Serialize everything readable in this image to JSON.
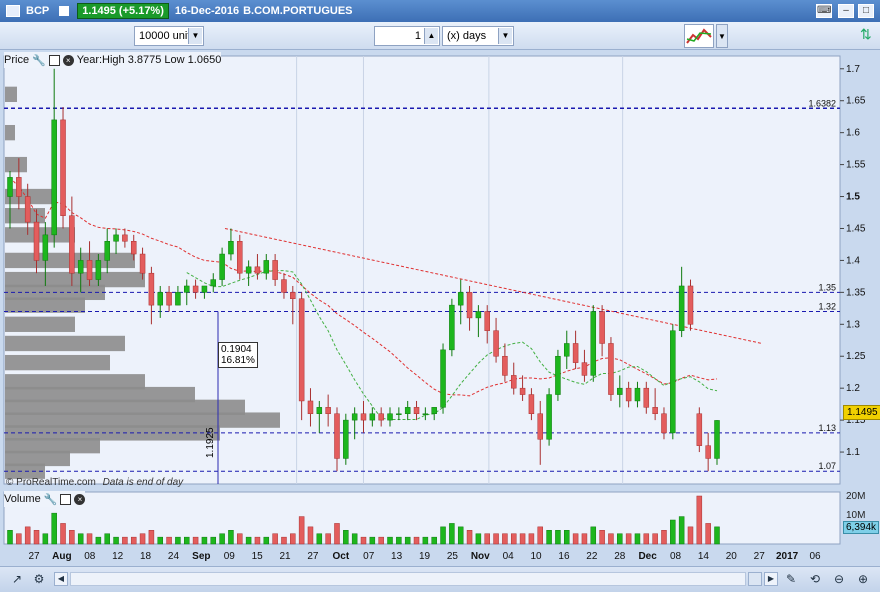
{
  "titlebar": {
    "symbol": "BCP",
    "price": "1.1495 (+5.17%)",
    "date": "16-Dec-2016",
    "exchange": "B.COM.PORTUGUES"
  },
  "toolbar": {
    "units_value": "10000 units",
    "period_value": "1",
    "period_unit": "(x) days"
  },
  "price_panel": {
    "label": "Price",
    "stats": "Year:High 3.8775 Low 1.0650",
    "watermark": "© ProRealTime.com",
    "end_note": "Data is end of day",
    "current_price": "1.1495",
    "measure_value": "0.1904",
    "measure_pct": "16.81%",
    "measure_low": "1.1925"
  },
  "volume_panel": {
    "label": "Volume",
    "current": "6,394k",
    "scale": [
      "20M",
      "10M"
    ]
  },
  "colors": {
    "up": "#1db61d",
    "down": "#e35d5d",
    "hline": "#1a1ab0",
    "ma": "#e03030",
    "ma2": "#44b044"
  },
  "chart_data": {
    "type": "candlestick",
    "y_axis_ticks": [
      "1.7",
      "1.65",
      "1.6",
      "1.55",
      "1.5",
      "1.45",
      "1.4",
      "1.35",
      "1.3",
      "1.25",
      "1.2",
      "1.15",
      "1.1"
    ],
    "ylim": [
      1.05,
      1.72
    ],
    "x_axis_ticks": [
      "27",
      "Aug",
      "08",
      "12",
      "18",
      "24",
      "Sep",
      "09",
      "15",
      "21",
      "27",
      "Oct",
      "07",
      "13",
      "19",
      "25",
      "Nov",
      "04",
      "10",
      "16",
      "22",
      "28",
      "Dec",
      "08",
      "14",
      "20",
      "27",
      "2017",
      "06"
    ],
    "horizontal_lines": [
      {
        "value": 1.6382,
        "label": "1.6382"
      },
      {
        "value": 1.35,
        "label": "1.35"
      },
      {
        "value": 1.32,
        "label": "1.32"
      },
      {
        "value": 1.13,
        "label": "1.13"
      },
      {
        "value": 1.07,
        "label": "1.07"
      }
    ],
    "candles": [
      [
        1.5,
        1.54,
        1.45,
        1.53
      ],
      [
        1.53,
        1.56,
        1.48,
        1.5
      ],
      [
        1.5,
        1.52,
        1.44,
        1.46
      ],
      [
        1.46,
        1.48,
        1.38,
        1.4
      ],
      [
        1.4,
        1.46,
        1.36,
        1.44
      ],
      [
        1.44,
        1.7,
        1.42,
        1.62
      ],
      [
        1.62,
        1.64,
        1.45,
        1.47
      ],
      [
        1.47,
        1.5,
        1.36,
        1.38
      ],
      [
        1.38,
        1.42,
        1.35,
        1.4
      ],
      [
        1.4,
        1.43,
        1.36,
        1.37
      ],
      [
        1.37,
        1.41,
        1.36,
        1.4
      ],
      [
        1.4,
        1.45,
        1.38,
        1.43
      ],
      [
        1.43,
        1.45,
        1.41,
        1.44
      ],
      [
        1.44,
        1.45,
        1.42,
        1.43
      ],
      [
        1.43,
        1.44,
        1.4,
        1.41
      ],
      [
        1.41,
        1.42,
        1.37,
        1.38
      ],
      [
        1.38,
        1.39,
        1.3,
        1.33
      ],
      [
        1.33,
        1.36,
        1.31,
        1.35
      ],
      [
        1.35,
        1.36,
        1.32,
        1.33
      ],
      [
        1.33,
        1.36,
        1.33,
        1.35
      ],
      [
        1.35,
        1.37,
        1.33,
        1.36
      ],
      [
        1.36,
        1.37,
        1.34,
        1.35
      ],
      [
        1.35,
        1.36,
        1.34,
        1.36
      ],
      [
        1.36,
        1.38,
        1.35,
        1.37
      ],
      [
        1.37,
        1.42,
        1.36,
        1.41
      ],
      [
        1.41,
        1.45,
        1.4,
        1.43
      ],
      [
        1.43,
        1.44,
        1.37,
        1.38
      ],
      [
        1.38,
        1.4,
        1.36,
        1.39
      ],
      [
        1.39,
        1.41,
        1.37,
        1.38
      ],
      [
        1.38,
        1.41,
        1.37,
        1.4
      ],
      [
        1.4,
        1.41,
        1.36,
        1.37
      ],
      [
        1.37,
        1.38,
        1.34,
        1.35
      ],
      [
        1.35,
        1.36,
        1.3,
        1.34
      ],
      [
        1.34,
        1.35,
        1.15,
        1.18
      ],
      [
        1.18,
        1.2,
        1.14,
        1.16
      ],
      [
        1.16,
        1.18,
        1.13,
        1.17
      ],
      [
        1.17,
        1.19,
        1.14,
        1.16
      ],
      [
        1.16,
        1.17,
        1.07,
        1.09
      ],
      [
        1.09,
        1.16,
        1.08,
        1.15
      ],
      [
        1.15,
        1.17,
        1.12,
        1.16
      ],
      [
        1.16,
        1.18,
        1.13,
        1.15
      ],
      [
        1.15,
        1.17,
        1.14,
        1.16
      ],
      [
        1.16,
        1.17,
        1.14,
        1.15
      ],
      [
        1.15,
        1.17,
        1.14,
        1.16
      ],
      [
        1.16,
        1.17,
        1.15,
        1.16
      ],
      [
        1.16,
        1.18,
        1.15,
        1.17
      ],
      [
        1.17,
        1.18,
        1.15,
        1.16
      ],
      [
        1.16,
        1.17,
        1.15,
        1.16
      ],
      [
        1.16,
        1.17,
        1.15,
        1.17
      ],
      [
        1.17,
        1.27,
        1.16,
        1.26
      ],
      [
        1.26,
        1.34,
        1.25,
        1.33
      ],
      [
        1.33,
        1.37,
        1.3,
        1.35
      ],
      [
        1.35,
        1.36,
        1.29,
        1.31
      ],
      [
        1.31,
        1.33,
        1.28,
        1.32
      ],
      [
        1.32,
        1.33,
        1.27,
        1.29
      ],
      [
        1.29,
        1.31,
        1.24,
        1.25
      ],
      [
        1.25,
        1.27,
        1.21,
        1.22
      ],
      [
        1.22,
        1.24,
        1.19,
        1.2
      ],
      [
        1.2,
        1.22,
        1.18,
        1.19
      ],
      [
        1.19,
        1.2,
        1.15,
        1.16
      ],
      [
        1.16,
        1.18,
        1.08,
        1.12
      ],
      [
        1.12,
        1.2,
        1.11,
        1.19
      ],
      [
        1.19,
        1.26,
        1.18,
        1.25
      ],
      [
        1.25,
        1.29,
        1.23,
        1.27
      ],
      [
        1.27,
        1.29,
        1.23,
        1.24
      ],
      [
        1.24,
        1.26,
        1.21,
        1.22
      ],
      [
        1.22,
        1.33,
        1.21,
        1.32
      ],
      [
        1.32,
        1.33,
        1.25,
        1.27
      ],
      [
        1.27,
        1.28,
        1.18,
        1.19
      ],
      [
        1.19,
        1.22,
        1.17,
        1.2
      ],
      [
        1.2,
        1.21,
        1.17,
        1.18
      ],
      [
        1.18,
        1.21,
        1.17,
        1.2
      ],
      [
        1.2,
        1.21,
        1.16,
        1.17
      ],
      [
        1.17,
        1.2,
        1.15,
        1.16
      ],
      [
        1.16,
        1.17,
        1.12,
        1.13
      ],
      [
        1.13,
        1.3,
        1.12,
        1.29
      ],
      [
        1.29,
        1.39,
        1.28,
        1.36
      ],
      [
        1.36,
        1.37,
        1.29,
        1.3
      ],
      [
        1.16,
        1.17,
        1.1,
        1.11
      ],
      [
        1.11,
        1.13,
        1.07,
        1.09
      ],
      [
        1.09,
        1.15,
        1.08,
        1.1495
      ]
    ],
    "volumes": [
      4,
      3,
      5,
      4,
      3,
      9,
      6,
      4,
      3,
      3,
      2,
      3,
      2,
      2,
      2,
      3,
      4,
      2,
      2,
      2,
      2,
      2,
      2,
      2,
      3,
      4,
      3,
      2,
      2,
      2,
      3,
      2,
      3,
      8,
      5,
      3,
      3,
      6,
      4,
      3,
      2,
      2,
      2,
      2,
      2,
      2,
      2,
      2,
      2,
      5,
      6,
      5,
      4,
      3,
      3,
      3,
      3,
      3,
      3,
      3,
      5,
      4,
      4,
      4,
      3,
      3,
      5,
      4,
      3,
      3,
      3,
      3,
      3,
      3,
      4,
      7,
      8,
      5,
      14,
      6,
      5
    ]
  }
}
